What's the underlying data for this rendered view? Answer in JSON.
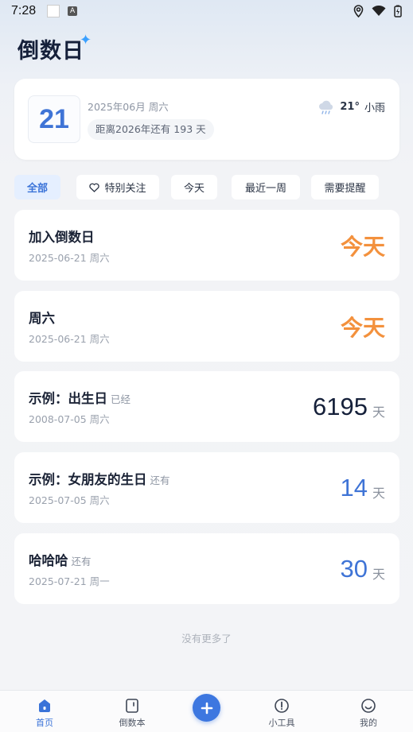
{
  "status_bar": {
    "time": "7:28"
  },
  "app": {
    "title": "倒数日"
  },
  "date_card": {
    "day": "21",
    "date_line": "2025年06月 周六",
    "remaining": "距离2026年还有 193 天",
    "weather": {
      "temp": "21°",
      "condition": "小雨",
      "icon": "cloud-rain-icon"
    }
  },
  "filters": [
    {
      "label": "全部",
      "active": true
    },
    {
      "label": "特别关注",
      "icon": "heart-icon"
    },
    {
      "label": "今天"
    },
    {
      "label": "最近一周"
    },
    {
      "label": "需要提醒"
    }
  ],
  "events": [
    {
      "title": "加入倒数日",
      "state": "",
      "date": "2025-06-21 周六",
      "value": "今天",
      "unit": ""
    },
    {
      "title": "周六",
      "state": "",
      "date": "2025-06-21 周六",
      "value": "今天",
      "unit": ""
    },
    {
      "title": "示例：出生日",
      "state": "已经",
      "date": "2008-07-05 周六",
      "value": "6195",
      "unit": "天",
      "color": "#15203a"
    },
    {
      "title": "示例：女朋友的生日",
      "state": "还有",
      "date": "2025-07-05 周六",
      "value": "14",
      "unit": "天",
      "color": "#3f74d6"
    },
    {
      "title": "哈哈哈",
      "state": "还有",
      "date": "2025-07-21 周一",
      "value": "30",
      "unit": "天",
      "color": "#3f74d6"
    }
  ],
  "list_footer": "没有更多了",
  "tabbar": [
    {
      "label": "首页",
      "icon": "home-icon",
      "active": true
    },
    {
      "label": "倒数本",
      "icon": "notebook-icon"
    },
    {
      "label": "",
      "icon": "plus-icon"
    },
    {
      "label": "小工具",
      "icon": "tools-icon"
    },
    {
      "label": "我的",
      "icon": "smile-icon"
    }
  ],
  "colors": {
    "accent": "#3d77e0",
    "today": "#f3913d"
  }
}
